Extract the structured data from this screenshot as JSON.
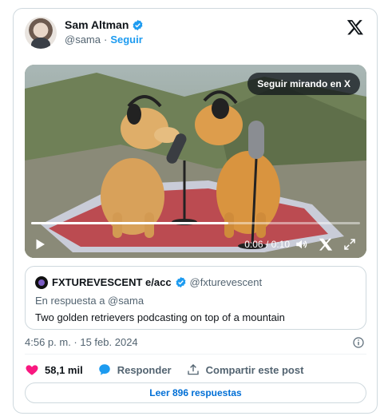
{
  "author": {
    "name": "Sam Altman",
    "handle": "@sama",
    "separator": "·",
    "follow_label": "Seguir"
  },
  "media": {
    "overlay_button": "Seguir mirando en X",
    "current_time": "0:06",
    "duration": "0:10",
    "time_separator": "/",
    "progress": 0.6
  },
  "quote": {
    "name": "FXTUREVESCENT e/acc",
    "handle": "@fxturevescent",
    "reply_to": "En respuesta a @sama",
    "text": "Two golden retrievers podcasting on top of a mountain"
  },
  "timestamp": "4:56 p. m. · 15 feb. 2024",
  "actions": {
    "likes": "58,1 mil",
    "reply_label": "Responder",
    "share_label": "Compartir este post"
  },
  "read_replies_label": "Leer 896 respuestas",
  "colors": {
    "accent": "#1d9bf0",
    "like": "#f91880",
    "link": "#006fd6",
    "border": "#cfd9de",
    "secondary_text": "#536471"
  },
  "icons": [
    "verified-badge-icon",
    "x-logo-icon",
    "play-icon",
    "volume-icon",
    "fullscreen-icon",
    "heart-icon",
    "reply-bubble-icon",
    "share-icon",
    "info-icon"
  ]
}
